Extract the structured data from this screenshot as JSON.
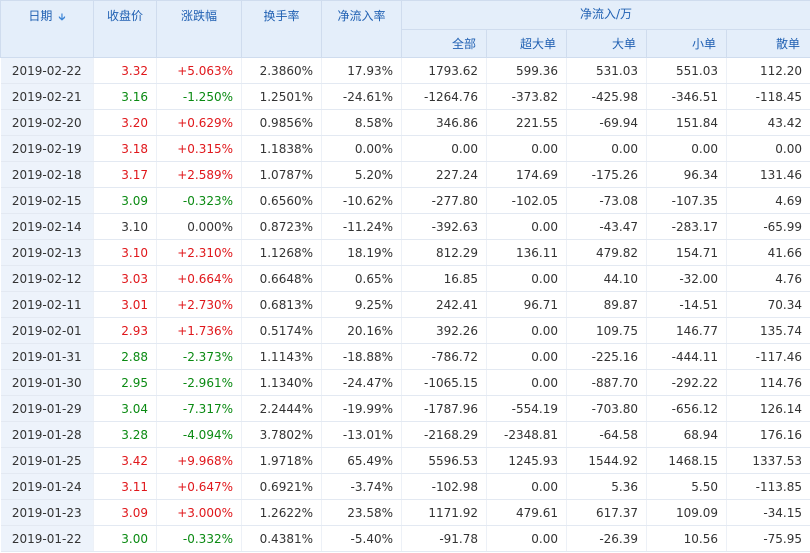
{
  "colors": {
    "up": "#e0171b",
    "down": "#0a8a12",
    "header_text": "#2161b3",
    "header_bg": "#e4eefa"
  },
  "headers": {
    "date": "日期",
    "close": "收盘价",
    "change_pct": "涨跌幅",
    "turnover": "换手率",
    "net_inflow_rate": "净流入率",
    "net_inflow_group": "净流入/万",
    "all": "全部",
    "super_large": "超大单",
    "large": "大单",
    "small": "小单",
    "retail": "散单"
  },
  "sort_icon": "sort-down-arrow-icon",
  "rows": [
    [
      "2019-02-22",
      "3.32",
      "+5.063%",
      "2.3860%",
      "17.93%",
      "1793.62",
      "599.36",
      "531.03",
      "551.03",
      "112.20"
    ],
    [
      "2019-02-21",
      "3.16",
      "-1.250%",
      "1.2501%",
      "-24.61%",
      "-1264.76",
      "-373.82",
      "-425.98",
      "-346.51",
      "-118.45"
    ],
    [
      "2019-02-20",
      "3.20",
      "+0.629%",
      "0.9856%",
      "8.58%",
      "346.86",
      "221.55",
      "-69.94",
      "151.84",
      "43.42"
    ],
    [
      "2019-02-19",
      "3.18",
      "+0.315%",
      "1.1838%",
      "0.00%",
      "0.00",
      "0.00",
      "0.00",
      "0.00",
      "0.00"
    ],
    [
      "2019-02-18",
      "3.17",
      "+2.589%",
      "1.0787%",
      "5.20%",
      "227.24",
      "174.69",
      "-175.26",
      "96.34",
      "131.46"
    ],
    [
      "2019-02-15",
      "3.09",
      "-0.323%",
      "0.6560%",
      "-10.62%",
      "-277.80",
      "-102.05",
      "-73.08",
      "-107.35",
      "4.69"
    ],
    [
      "2019-02-14",
      "3.10",
      "0.000%",
      "0.8723%",
      "-11.24%",
      "-392.63",
      "0.00",
      "-43.47",
      "-283.17",
      "-65.99"
    ],
    [
      "2019-02-13",
      "3.10",
      "+2.310%",
      "1.1268%",
      "18.19%",
      "812.29",
      "136.11",
      "479.82",
      "154.71",
      "41.66"
    ],
    [
      "2019-02-12",
      "3.03",
      "+0.664%",
      "0.6648%",
      "0.65%",
      "16.85",
      "0.00",
      "44.10",
      "-32.00",
      "4.76"
    ],
    [
      "2019-02-11",
      "3.01",
      "+2.730%",
      "0.6813%",
      "9.25%",
      "242.41",
      "96.71",
      "89.87",
      "-14.51",
      "70.34"
    ],
    [
      "2019-02-01",
      "2.93",
      "+1.736%",
      "0.5174%",
      "20.16%",
      "392.26",
      "0.00",
      "109.75",
      "146.77",
      "135.74"
    ],
    [
      "2019-01-31",
      "2.88",
      "-2.373%",
      "1.1143%",
      "-18.88%",
      "-786.72",
      "0.00",
      "-225.16",
      "-444.11",
      "-117.46"
    ],
    [
      "2019-01-30",
      "2.95",
      "-2.961%",
      "1.1340%",
      "-24.47%",
      "-1065.15",
      "0.00",
      "-887.70",
      "-292.22",
      "114.76"
    ],
    [
      "2019-01-29",
      "3.04",
      "-7.317%",
      "2.2444%",
      "-19.99%",
      "-1787.96",
      "-554.19",
      "-703.80",
      "-656.12",
      "126.14"
    ],
    [
      "2019-01-28",
      "3.28",
      "-4.094%",
      "3.7802%",
      "-13.01%",
      "-2168.29",
      "-2348.81",
      "-64.58",
      "68.94",
      "176.16"
    ],
    [
      "2019-01-25",
      "3.42",
      "+9.968%",
      "1.9718%",
      "65.49%",
      "5596.53",
      "1245.93",
      "1544.92",
      "1468.15",
      "1337.53"
    ],
    [
      "2019-01-24",
      "3.11",
      "+0.647%",
      "0.6921%",
      "-3.74%",
      "-102.98",
      "0.00",
      "5.36",
      "5.50",
      "-113.85"
    ],
    [
      "2019-01-23",
      "3.09",
      "+3.000%",
      "1.2622%",
      "23.58%",
      "1171.92",
      "479.61",
      "617.37",
      "109.09",
      "-34.15"
    ],
    [
      "2019-01-22",
      "3.00",
      "-0.332%",
      "0.4381%",
      "-5.40%",
      "-91.78",
      "0.00",
      "-26.39",
      "10.56",
      "-75.95"
    ]
  ]
}
